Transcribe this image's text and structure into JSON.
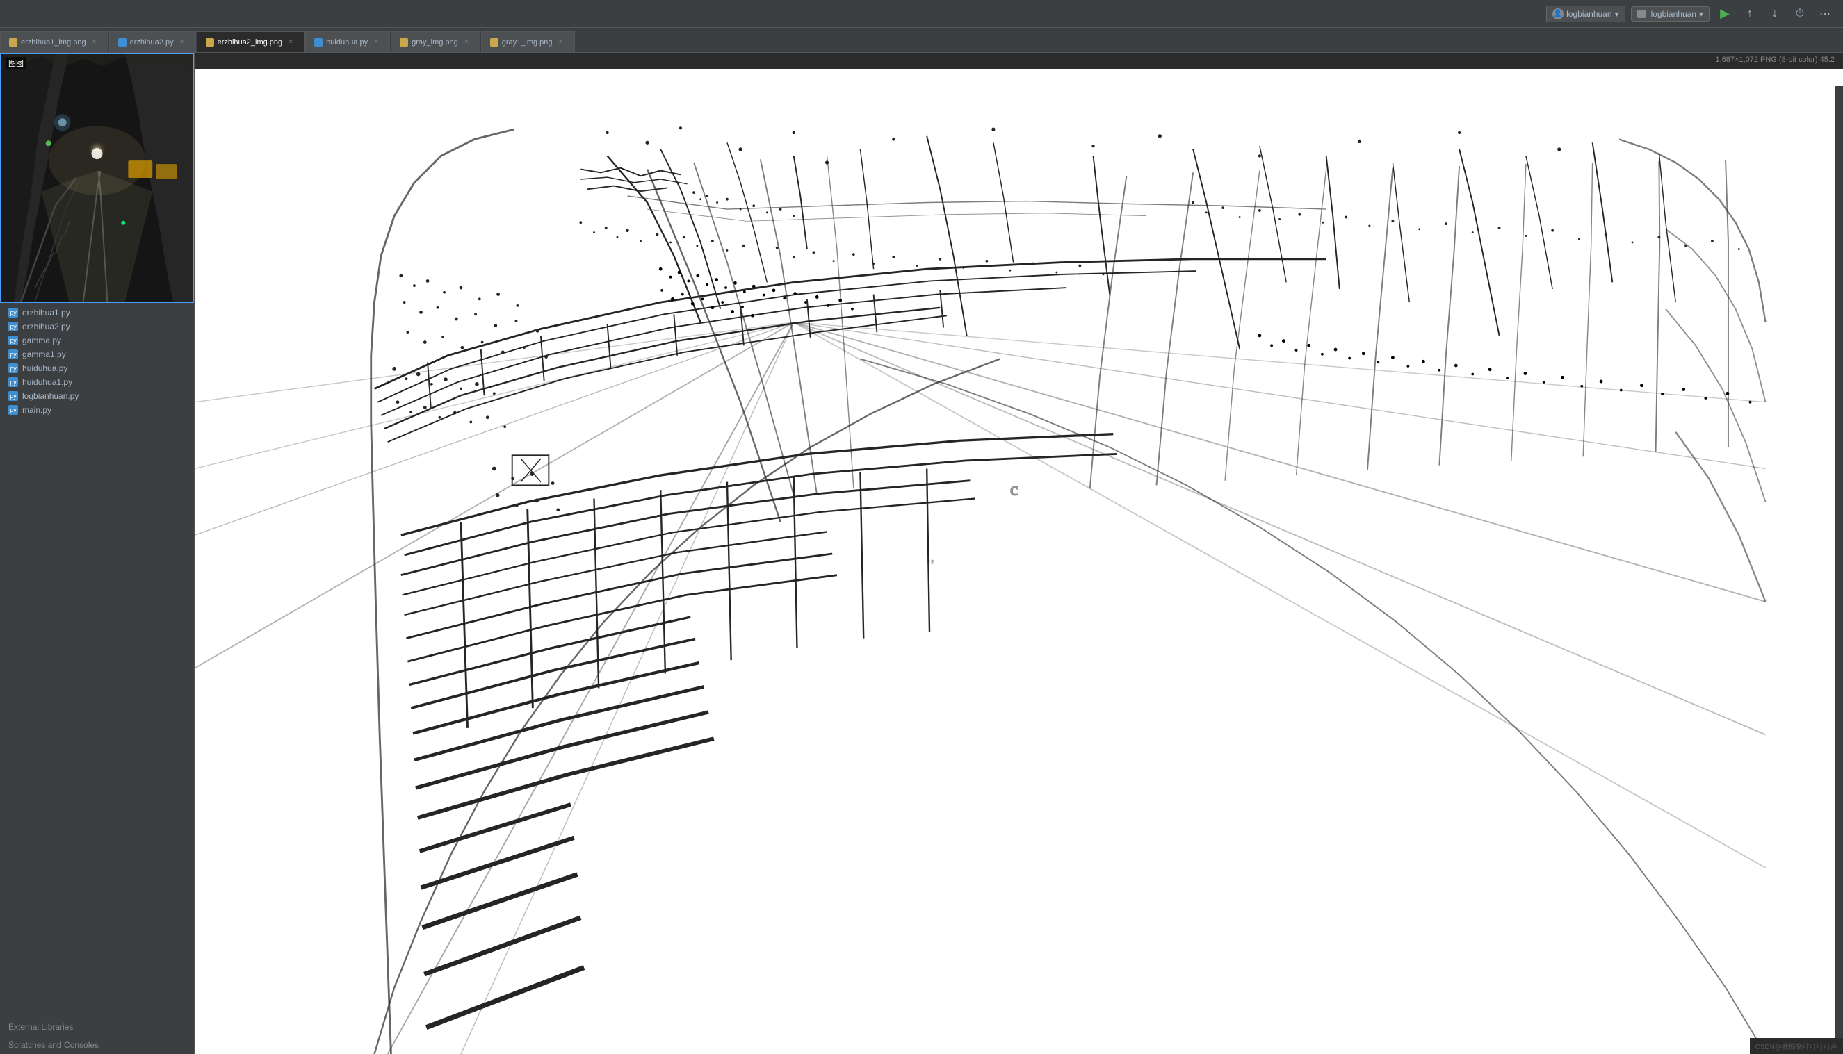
{
  "toolbar": {
    "user_label": "logbianhuan",
    "branch_label": "logbianhuan",
    "run_icon": "▶",
    "chevron_down": "▾"
  },
  "tabs": [
    {
      "id": "erzhihua1_img",
      "label": "erzhihua1_img.png",
      "type": "png",
      "active": false
    },
    {
      "id": "erzhihua2",
      "label": "erzhihua2.py",
      "type": "py",
      "active": false
    },
    {
      "id": "erzhihua2_img",
      "label": "erzhihua2_img.png",
      "type": "png",
      "active": true
    },
    {
      "id": "huiduhua",
      "label": "huiduhua.py",
      "type": "py",
      "active": false
    },
    {
      "id": "gray_img",
      "label": "gray_img.png",
      "type": "png",
      "active": false
    },
    {
      "id": "gray1_img",
      "label": "gray1_img.png",
      "type": "png",
      "active": false
    }
  ],
  "image_info": "1,687×1,072 PNG (8-bit color) 45.2",
  "file_tree": {
    "items": [
      {
        "name": "erzhihua1.py",
        "type": "py"
      },
      {
        "name": "erzhihua2.py",
        "type": "py"
      },
      {
        "name": "gamma.py",
        "type": "py"
      },
      {
        "name": "gamma1.py",
        "type": "py"
      },
      {
        "name": "huiduhua.py",
        "type": "py"
      },
      {
        "name": "huiduhua1.py",
        "type": "py"
      },
      {
        "name": "logbianhuan.py",
        "type": "py"
      },
      {
        "name": "main.py",
        "type": "py"
      }
    ],
    "external_libraries": "External Libraries",
    "scratches_consoles": "Scratches and Consoles"
  },
  "preview": {
    "label": "图图"
  },
  "watermark": "CSDN@我脑袋咔叮叮叮声",
  "icons": {
    "file_py": "py",
    "file_png": "p",
    "close": "×",
    "gear": "⚙",
    "search": "🔍",
    "add": "+",
    "commit": "↑",
    "update": "↓",
    "history": "⏱"
  }
}
